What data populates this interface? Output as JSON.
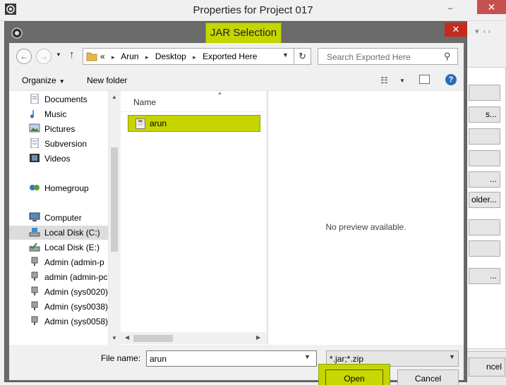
{
  "parent_window": {
    "title": "Properties for Project 017",
    "minimize_glyph": "–",
    "close_glyph": "✕",
    "side_buttons": [
      "",
      "s...",
      "",
      "",
      "...",
      "older...",
      "",
      "",
      "..."
    ],
    "cancel_label": "ncel"
  },
  "dialog": {
    "title": "JAR Selection",
    "close_glyph": "✕",
    "address": {
      "overflow": "«",
      "crumbs": [
        "Arun",
        "Desktop",
        "Exported Here"
      ]
    },
    "search": {
      "placeholder": "Search Exported Here"
    },
    "toolbar": {
      "organize_label": "Organize",
      "new_folder_label": "New folder",
      "help_glyph": "?"
    },
    "nav_items": [
      {
        "label": "Documents",
        "icon": "documents-icon"
      },
      {
        "label": "Music",
        "icon": "music-icon"
      },
      {
        "label": "Pictures",
        "icon": "pictures-icon"
      },
      {
        "label": "Subversion",
        "icon": "subversion-icon"
      },
      {
        "label": "Videos",
        "icon": "videos-icon"
      },
      {
        "label": "Homegroup",
        "icon": "homegroup-icon"
      },
      {
        "label": "Computer",
        "icon": "computer-icon"
      },
      {
        "label": "Local Disk (C:)",
        "icon": "drive-icon",
        "selected": true
      },
      {
        "label": "Local Disk (E:)",
        "icon": "drive-icon"
      },
      {
        "label": "Admin (admin-p",
        "icon": "network-drive-icon"
      },
      {
        "label": "admin (admin-pc",
        "icon": "network-drive-icon"
      },
      {
        "label": "Admin (sys0020)",
        "icon": "network-drive-icon"
      },
      {
        "label": "Admin (sys0038)",
        "icon": "network-drive-icon"
      },
      {
        "label": "Admin (sys0058)",
        "icon": "network-drive-icon"
      }
    ],
    "file_list": {
      "column_name": "Name",
      "files": [
        {
          "name": "arun",
          "icon": "jar-file-icon"
        }
      ]
    },
    "preview_text": "No preview available.",
    "file_name_label": "File name:",
    "file_name_value": "arun",
    "file_type_value": "*.jar;*.zip",
    "open_label": "Open",
    "cancel_label": "Cancel"
  },
  "colors": {
    "highlight": "#c5d500",
    "dialog_frame": "#6b6b6b",
    "close_red": "#c42b1c"
  }
}
